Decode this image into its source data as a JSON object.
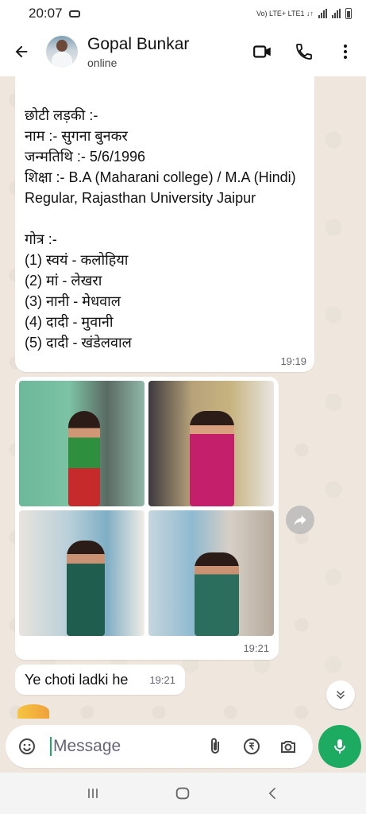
{
  "status_bar": {
    "time": "20:07",
    "net_label": "Vo) LTE+ LTE1 ↓↑"
  },
  "header": {
    "contact_name": "Gopal Bunkar",
    "presence": "online"
  },
  "messages": [
    {
      "text": "छोटी लड़की :-\nनाम :- सुगना बुनकर\nजन्मतिथि :- 5/6/1996\nशिक्षा :- B.A (Maharani college) / M.A (Hindi) Regular, Rajasthan University Jaipur\n\nगोत्र :-\n(1) स्वयं - कलोहिया\n(2) मां - लेखरा\n(3) नानी - मेधवाल\n(4) दादी - मुवानी\n(5) दादी - खंडेलवाल",
      "time": "19:19"
    },
    {
      "type": "photo-album",
      "photo_count": 4,
      "time": "19:21"
    },
    {
      "text": "Ye choti ladki he",
      "time": "19:21"
    }
  ],
  "composer": {
    "placeholder": "Message"
  },
  "colors": {
    "accent": "#1daa61",
    "chat_bg": "#efe7de",
    "bubble": "#ffffff"
  },
  "icons": [
    "back-arrow-icon",
    "video-call-icon",
    "voice-call-icon",
    "more-options-icon",
    "forward-icon",
    "scroll-down-icon",
    "emoji-icon",
    "attach-icon",
    "rupee-icon",
    "camera-icon",
    "mic-icon",
    "recents-icon",
    "home-icon",
    "nav-back-icon"
  ]
}
